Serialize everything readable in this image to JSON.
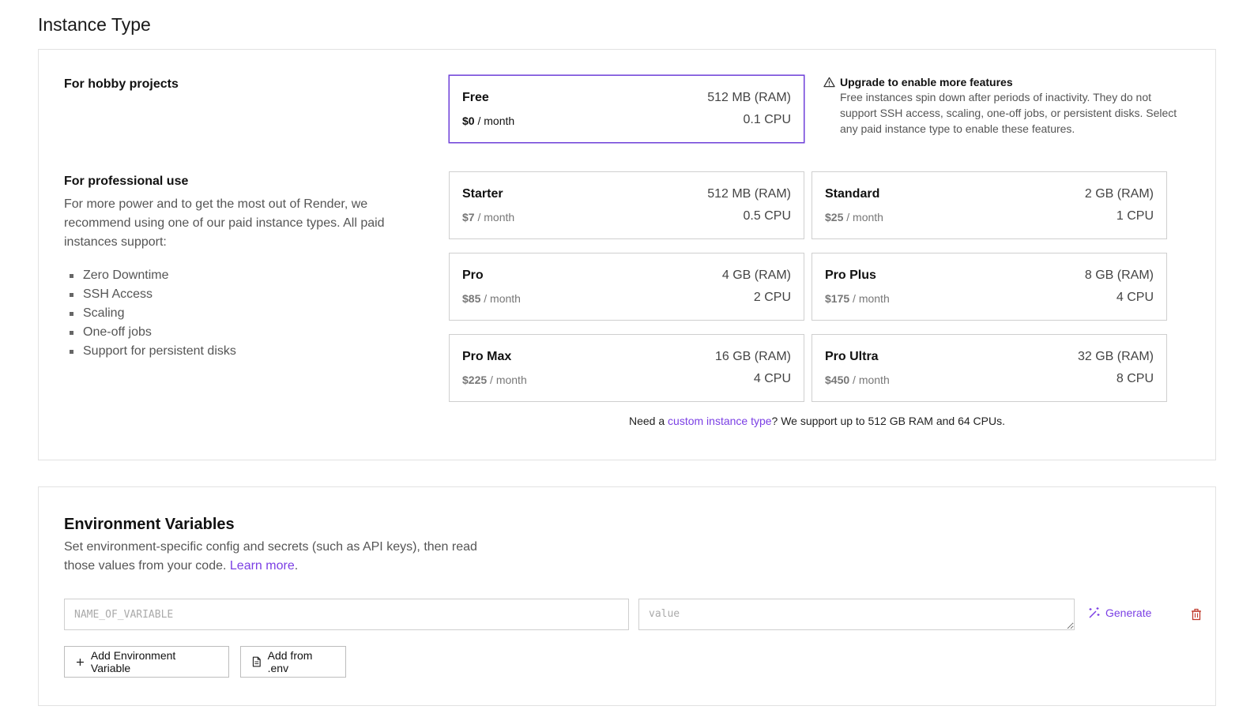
{
  "instance_section": {
    "title": "Instance Type",
    "hobby_heading": "For hobby projects",
    "pro_heading": "For professional use",
    "pro_description": "For more power and to get the most out of Render, we recommend using one of our paid instance types. All paid instances support:",
    "features": [
      "Zero Downtime",
      "SSH Access",
      "Scaling",
      "One-off jobs",
      "Support for persistent disks"
    ],
    "upgrade": {
      "title": "Upgrade to enable more features",
      "text": "Free instances spin down after periods of inactivity. They do not support SSH access, scaling, one-off jobs, or persistent disks. Select any paid instance type to enable these features.",
      "icon": "warning-icon"
    },
    "per_month": "/ month",
    "plans": [
      {
        "name": "Free",
        "price": "$0",
        "ram": "512 MB (RAM)",
        "cpu": "0.1 CPU",
        "selected": true
      },
      {
        "name": "Starter",
        "price": "$7",
        "ram": "512 MB (RAM)",
        "cpu": "0.5 CPU",
        "selected": false
      },
      {
        "name": "Standard",
        "price": "$25",
        "ram": "2 GB (RAM)",
        "cpu": "1 CPU",
        "selected": false
      },
      {
        "name": "Pro",
        "price": "$85",
        "ram": "4 GB (RAM)",
        "cpu": "2 CPU",
        "selected": false
      },
      {
        "name": "Pro Plus",
        "price": "$175",
        "ram": "8 GB (RAM)",
        "cpu": "4 CPU",
        "selected": false
      },
      {
        "name": "Pro Max",
        "price": "$225",
        "ram": "16 GB (RAM)",
        "cpu": "4 CPU",
        "selected": false
      },
      {
        "name": "Pro Ultra",
        "price": "$450",
        "ram": "32 GB (RAM)",
        "cpu": "8 CPU",
        "selected": false
      }
    ],
    "custom_note": {
      "prefix": "Need a ",
      "link": "custom instance type",
      "suffix": "? We support up to 512 GB RAM and 64 CPUs."
    }
  },
  "env_section": {
    "title": "Environment Variables",
    "description": "Set environment-specific config and secrets (such as API keys), then read those values from your code. ",
    "learn_more": "Learn more",
    "learn_more_suffix": ".",
    "name_placeholder": "NAME_OF_VARIABLE",
    "value_placeholder": "value",
    "generate_label": "Generate",
    "add_variable_label": "Add Environment Variable",
    "add_from_env_label": "Add from .env"
  },
  "colors": {
    "accent": "#7b3fe4",
    "selected_border": "#6e3fd8",
    "delete": "#c0392b",
    "border": "#cfcfcf"
  }
}
